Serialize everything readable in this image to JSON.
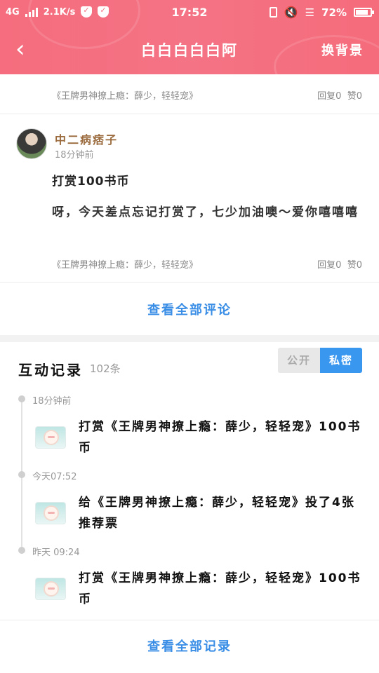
{
  "status_bar": {
    "network": "4G",
    "speed": "2.1K/s",
    "time": "17:52",
    "battery": "72%"
  },
  "header": {
    "title": "白白白白白阿",
    "change_bg": "换背景"
  },
  "comments": [
    {
      "book": "《王牌男神撩上瘾：薛少，轻轻宠》",
      "replies": "回复0",
      "likes": "赞0"
    },
    {
      "username": "中二病痞子",
      "time": "18分钟前",
      "line1": "打赏100书币",
      "line2": "呀，今天差点忘记打赏了，七少加油噢～爱你嘻嘻嘻",
      "book": "《王牌男神撩上瘾：薛少，轻轻宠》",
      "replies": "回复0",
      "likes": "赞0"
    }
  ],
  "view_all_comments": "查看全部评论",
  "interactions": {
    "title": "互动记录",
    "count": "102条",
    "toggle_public": "公开",
    "toggle_private": "私密",
    "items": [
      {
        "time": "18分钟前",
        "text": "打赏《王牌男神撩上瘾：薛少，轻轻宠》100书币"
      },
      {
        "time": "今天07:52",
        "text": "给《王牌男神撩上瘾：薛少，轻轻宠》投了4张推荐票"
      },
      {
        "time": "昨天 09:24",
        "text": "打赏《王牌男神撩上瘾：薛少，轻轻宠》100书币"
      }
    ]
  },
  "view_all_records": "查看全部记录",
  "colors": {
    "header": "#f47384",
    "link": "#3a8ee6",
    "toggle_active": "#3a97f0",
    "username": "#9a6a3c"
  }
}
